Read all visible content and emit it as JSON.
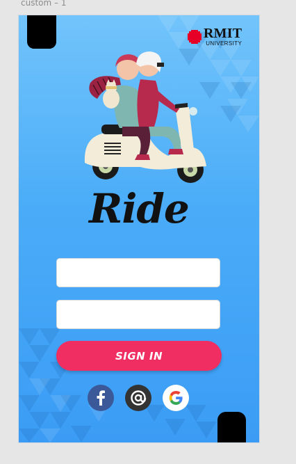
{
  "canvas": {
    "frame_label": "custom – 1"
  },
  "brand": {
    "name": "RMIT",
    "sub": "UNIVERSITY",
    "accent": "#e60028"
  },
  "app": {
    "title": "Ride"
  },
  "form": {
    "username": {
      "value": "",
      "placeholder": ""
    },
    "password": {
      "value": "",
      "placeholder": ""
    },
    "signin_label": "SIGN IN",
    "signin_color": "#f12e62"
  },
  "social": [
    {
      "name": "facebook",
      "icon": "facebook-icon",
      "color": "#3b5998"
    },
    {
      "name": "email",
      "icon": "at-icon",
      "color": "#333333"
    },
    {
      "name": "google",
      "icon": "google-icon",
      "color": "#ffffff"
    }
  ],
  "colors": {
    "background_top": "#72c4fb",
    "background_bottom": "#3b9cf5"
  }
}
